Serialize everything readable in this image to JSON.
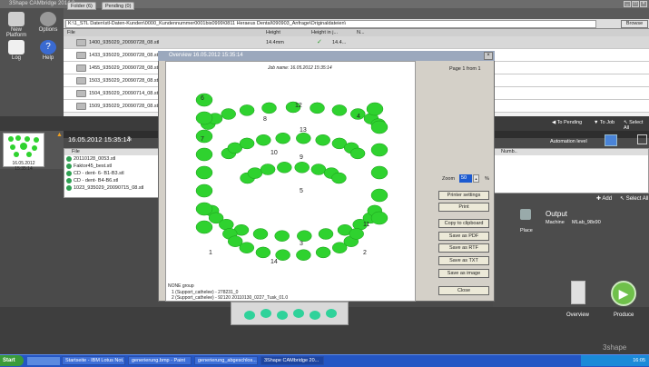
{
  "app": {
    "title": "3Shape CAMbridge 2014.0"
  },
  "toolbar": {
    "new_platform": "New Platform",
    "options": "Options",
    "log": "Log",
    "help": "Help"
  },
  "tabs": [
    {
      "label": "Folder (6)"
    },
    {
      "label": "Pending (0)"
    }
  ],
  "path": {
    "value": "K:\\1_STL Daten\\stl-Daten-Kunden\\0000_Kundennummer0001bis0999\\0811 Heraeus Dental\\090903_Anfrage\\Originaldateien\\",
    "browse": "Browse"
  },
  "file_table": {
    "headers": [
      "File",
      "Height",
      "Height in j...",
      "N..."
    ],
    "rows": [
      {
        "name": "1400_935029_20090728_08.stl",
        "height": "14.4mm",
        "check": "✓",
        "hj": "14.4..."
      },
      {
        "name": "1433_935029_20090728_08.stl",
        "height": "",
        "check": "",
        "hj": ""
      },
      {
        "name": "1455_935029_20090728_08.stl",
        "height": "",
        "check": "",
        "hj": ""
      },
      {
        "name": "1503_935029_20090728_08.stl",
        "height": "",
        "check": "",
        "hj": ""
      },
      {
        "name": "1504_935029_20090714_08.stl",
        "height": "",
        "check": "",
        "hj": ""
      },
      {
        "name": "1509_935029_20090728_08.stl",
        "height": "",
        "check": "",
        "hj": ""
      }
    ]
  },
  "actions": {
    "to_pending": "To Pending",
    "to_job": "To Job",
    "select_all": "Select All",
    "automation": "Automation level",
    "add": "Add",
    "select_all2": "Select All"
  },
  "job": {
    "thumb_label": "16.05.2012 15:35:14",
    "date": "16.05.2012 15:35:14",
    "list_header": "File",
    "items": [
      "20110128_0053.stl",
      "Faktor45_best.stl",
      "CD - dent- 6- B1-B3.stl",
      "CD - dent- B4-B6.stl",
      "1023_935029_20090715_08.stl"
    ]
  },
  "right": {
    "numb": "Numb..",
    "output": "Output",
    "machine_label": "Machine",
    "machine_value": "MLab_98x90",
    "place": "Place"
  },
  "bottom": {
    "overview": "Overview",
    "produce": "Produce",
    "brand": "3shape"
  },
  "dialog": {
    "title": "Overview  16.05.2012 15:35:14",
    "job_name": "Job name: 16.05.2012 15:35:14",
    "page": "Page 1 from 1",
    "zoom_label": "Zoom",
    "zoom_value": "50",
    "zoom_unit": "%",
    "buttons": [
      "Printer settings",
      "Print",
      "Copy to clipboard",
      "Save as PDF",
      "Save as RTF",
      "Save as TXT",
      "Save as image",
      "Close"
    ],
    "numbers": [
      "1",
      "2",
      "3",
      "4",
      "5",
      "6",
      "7",
      "8",
      "9",
      "10",
      "11",
      "12",
      "13",
      "14"
    ],
    "footer_group": "NONE group",
    "footer_l1": "1   (Support_cathelee) - 278231_0",
    "footer_l2": "2   (Support_cathelee) - 92120  20110130_0227_Tusk_01.0"
  },
  "taskbar": {
    "start": "Start",
    "tasks": [
      "Startseite - IBM Lotus Not...",
      "generierung.bmp - Paint",
      "generierung_abgeschlos...",
      "3Shape CAMbridge 20..."
    ],
    "clock": "16:05"
  },
  "colors": {
    "accent_green": "#2fd22f",
    "title_blue": "#9ba8bd",
    "taskbar_blue": "#2456c4"
  }
}
